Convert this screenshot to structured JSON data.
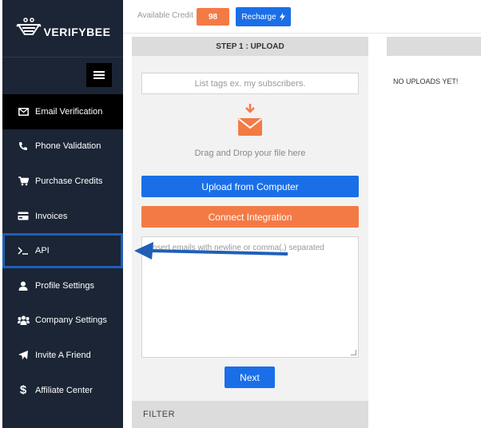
{
  "brand": {
    "name": "VERIFYBEE"
  },
  "sidebar": {
    "items": [
      {
        "label": "Email Verification",
        "icon": "envelope-icon"
      },
      {
        "label": "Phone Validation",
        "icon": "phone-icon"
      },
      {
        "label": "Purchase Credits",
        "icon": "cart-icon"
      },
      {
        "label": "Invoices",
        "icon": "credit-card-icon"
      },
      {
        "label": "API",
        "icon": "terminal-icon"
      },
      {
        "label": "Profile Settings",
        "icon": "user-icon"
      },
      {
        "label": "Company Settings",
        "icon": "users-icon"
      },
      {
        "label": "Invite A Friend",
        "icon": "paper-plane-icon"
      },
      {
        "label": "Affiliate Center",
        "icon": "dollar-icon"
      }
    ]
  },
  "topbar": {
    "credit_label": "Available Credit",
    "credit_value": "98",
    "recharge_label": "Recharge"
  },
  "upload": {
    "header": "STEP 1 : UPLOAD",
    "tags_placeholder": "List tags ex. my subscribers.",
    "drag_text": "Drag and Drop your file here",
    "upload_button": "Upload from Computer",
    "connect_button": "Connect Integration",
    "emails_placeholder": "Insert emails with newline or comma(,) separated",
    "next_button": "Next",
    "filter_label": "FILTER"
  },
  "uploads_panel": {
    "empty_text": "NO UPLOADS YET!"
  },
  "colors": {
    "sidebar": "#1b2535",
    "accent_blue": "#1a6fe8",
    "accent_orange": "#f47a45"
  }
}
